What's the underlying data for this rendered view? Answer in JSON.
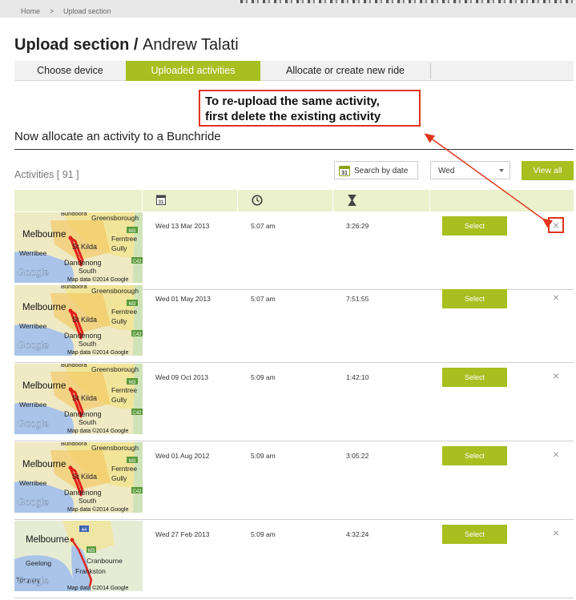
{
  "breadcrumb": {
    "home": "Home",
    "separator": ">",
    "current": "Upload section"
  },
  "page": {
    "title": "Upload section",
    "title_sep": " / ",
    "user": "Andrew Talati"
  },
  "tabs": [
    {
      "label": "Choose device",
      "active": false
    },
    {
      "label": "Uploaded activities",
      "active": true
    },
    {
      "label": "Allocate or create new ride",
      "active": false
    }
  ],
  "callout": {
    "line1": "To re-upload the same activity,",
    "line2": "first delete the existing activity"
  },
  "section": {
    "title": "Now allocate an activity to a Bunchride"
  },
  "activities": {
    "label": "Activities [ 91 ]"
  },
  "filters": {
    "search_date_label": "Search by date",
    "calendar_day": "31",
    "day_value": "Wed",
    "view_all_label": "View all"
  },
  "table_header": {
    "date_icon": "calendar-icon",
    "time_icon": "clock-icon",
    "duration_icon": "hourglass-icon"
  },
  "map_labels": {
    "melbourne": "Melbourne",
    "greensborough": "Greensborough",
    "bundoora": "Bundoora",
    "ferntree": "Ferntree",
    "gully": "Gully",
    "st_kilda": "St Kilda",
    "werribee": "Werribee",
    "dandenong": "Dandenong",
    "south": "South",
    "m3": "M3",
    "c42": "C42",
    "google": "Google",
    "map_data": "Map data ©2014 Google",
    "geelong": "Geelong",
    "cranbourne": "Cranbourne",
    "frankston": "Frankston",
    "torquay": "Torquay",
    "route_44": "44"
  },
  "rows": [
    {
      "date": "Wed 13 Mar 2013",
      "time": "5:07 am",
      "duration": "3:26:29",
      "select_label": "Select",
      "delete_label": "×"
    },
    {
      "date": "Wed 01 May 2013",
      "time": "5:07 am",
      "duration": "7:51:55",
      "select_label": "Select",
      "delete_label": "×"
    },
    {
      "date": "Wed 09 Oct 2013",
      "time": "5:09 am",
      "duration": "1:42:10",
      "select_label": "Select",
      "delete_label": "×"
    },
    {
      "date": "Wed 01 Aug 2012",
      "time": "5:09 am",
      "duration": "3:05:22",
      "select_label": "Select",
      "delete_label": "×"
    },
    {
      "date": "Wed 27 Feb 2013",
      "time": "5:09 am",
      "duration": "4:32:24",
      "select_label": "Select",
      "delete_label": "×"
    }
  ],
  "colors": {
    "accent": "#a7bf1f",
    "header_bg": "#eaf1cc",
    "callout_border": "#e0341c",
    "route": "#e0201c",
    "water": "#a9c4e8",
    "urban": "#f1e59a"
  }
}
